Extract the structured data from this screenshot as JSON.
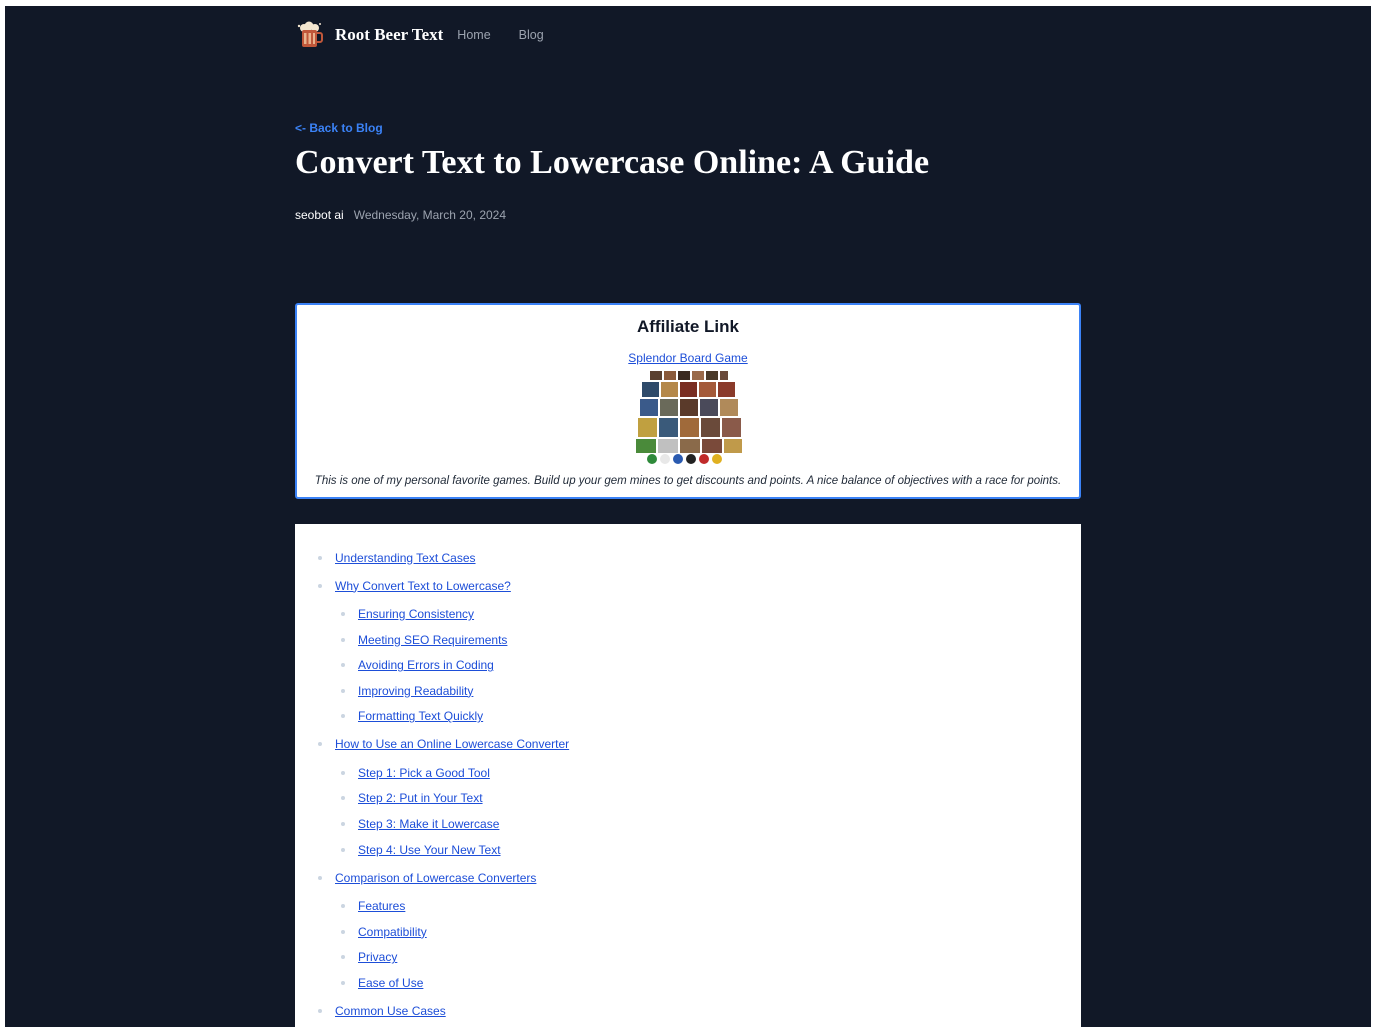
{
  "header": {
    "brand": "Root Beer Text",
    "nav": [
      {
        "label": "Home"
      },
      {
        "label": "Blog"
      }
    ]
  },
  "article": {
    "back_link": "<- Back to Blog",
    "title": "Convert Text to Lowercase Online: A Guide",
    "author": "seobot ai",
    "date": "Wednesday, March 20, 2024"
  },
  "affiliate": {
    "heading": "Affiliate Link",
    "link_text": "Splendor Board Game",
    "description": "This is one of my personal favorite games. Build up your gem mines to get discounts and points. A nice balance of objectives with a race for points."
  },
  "toc": [
    {
      "label": "Understanding Text Cases",
      "children": []
    },
    {
      "label": "Why Convert Text to Lowercase?",
      "children": [
        {
          "label": "Ensuring Consistency"
        },
        {
          "label": "Meeting SEO Requirements"
        },
        {
          "label": "Avoiding Errors in Coding"
        },
        {
          "label": "Improving Readability"
        },
        {
          "label": "Formatting Text Quickly"
        }
      ]
    },
    {
      "label": "How to Use an Online Lowercase Converter",
      "children": [
        {
          "label": "Step 1: Pick a Good Tool"
        },
        {
          "label": "Step 2: Put in Your Text"
        },
        {
          "label": "Step 3: Make it Lowercase"
        },
        {
          "label": "Step 4: Use Your New Text"
        }
      ]
    },
    {
      "label": "Comparison of Lowercase Converters",
      "children": [
        {
          "label": "Features"
        },
        {
          "label": "Compatibility"
        },
        {
          "label": "Privacy"
        },
        {
          "label": "Ease of Use"
        }
      ]
    },
    {
      "label": "Common Use Cases",
      "children": []
    }
  ],
  "colors": {
    "page_bg": "#111827",
    "accent": "#3b82f6",
    "link": "#1d4ed8"
  },
  "icons": {
    "logo": "root-beer-mug-icon"
  }
}
